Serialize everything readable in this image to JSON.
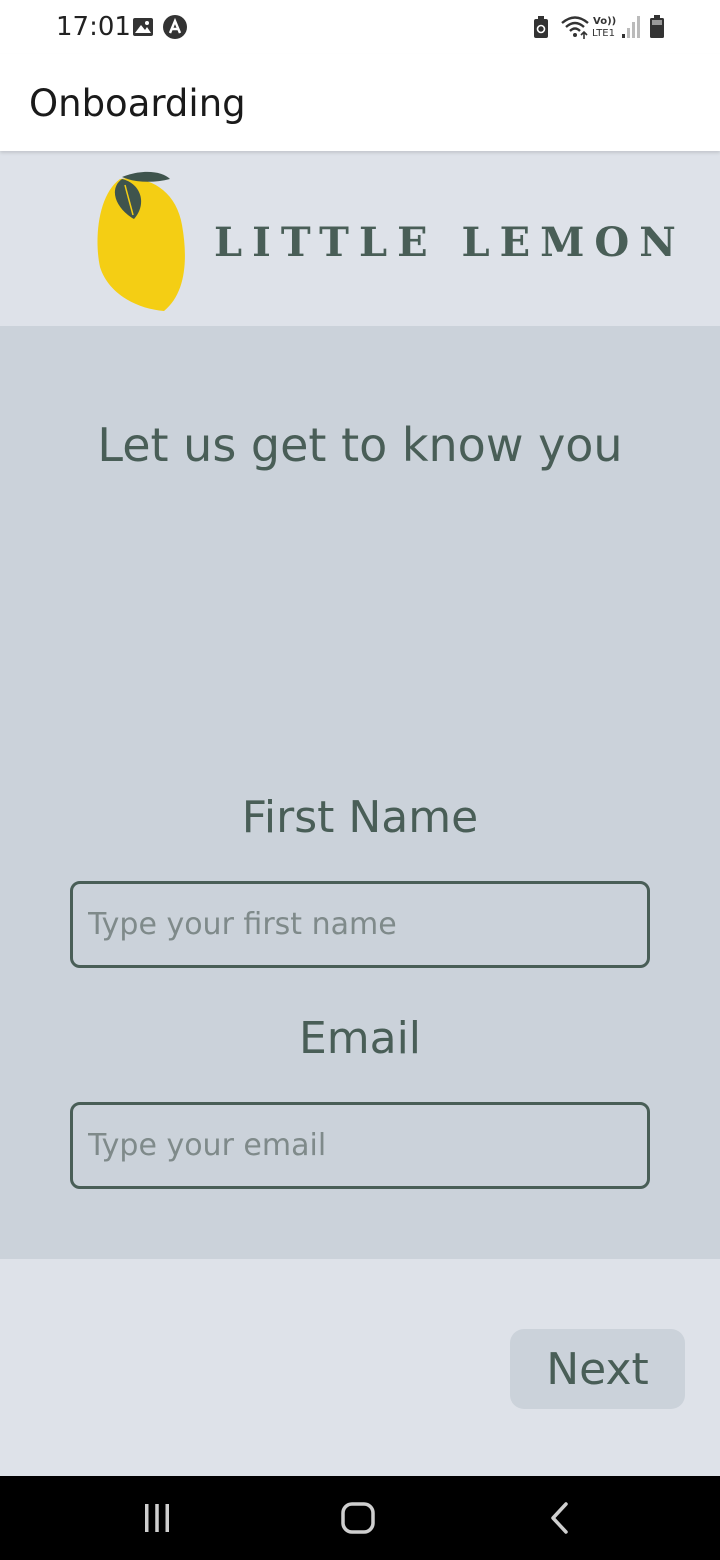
{
  "status_bar": {
    "time": "17:01",
    "icons": [
      "gallery-icon",
      "app-notification-icon",
      "battery-saver-icon",
      "wifi-icon",
      "volte-icon",
      "signal-icon",
      "battery-icon"
    ],
    "volte_text": "Vo))",
    "lte_text": "LTE1"
  },
  "app_bar": {
    "title": "Onboarding"
  },
  "header": {
    "logo_text": "LITTLE LEMON",
    "lemon_color": "#F4CE14",
    "leaf_color": "#495E57"
  },
  "form": {
    "heading": "Let us get to know you",
    "first_name_label": "First Name",
    "first_name_placeholder": "Type your first name",
    "first_name_value": "",
    "email_label": "Email",
    "email_placeholder": "Type your email",
    "email_value": ""
  },
  "footer": {
    "next_label": "Next"
  },
  "nav_bar": {
    "icons": [
      "recent-apps-icon",
      "home-icon",
      "back-icon"
    ]
  },
  "colors": {
    "primary_green": "#495E57",
    "header_bg": "#DEE2E9",
    "main_bg": "#CBD2DA",
    "lemon_yellow": "#F4CE14"
  }
}
